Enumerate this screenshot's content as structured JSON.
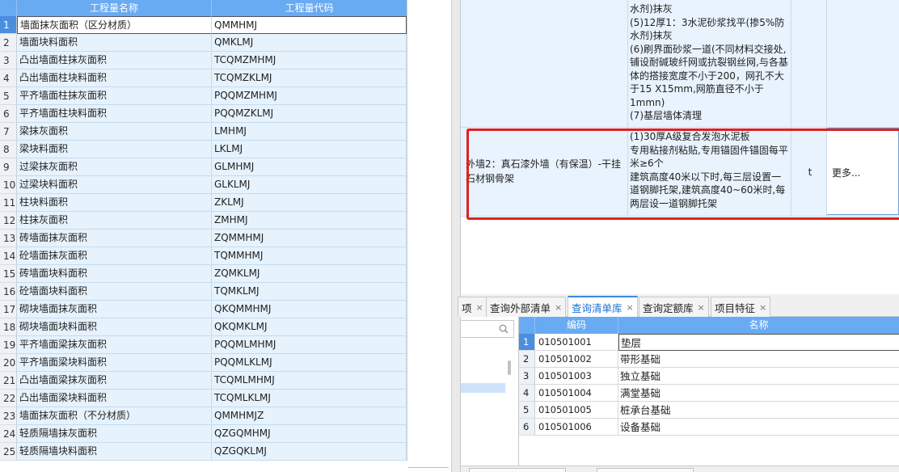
{
  "left_table": {
    "headers": {
      "name": "工程量名称",
      "code": "工程量代码"
    },
    "rows": [
      {
        "num": "1",
        "name": "墙面抹灰面积（区分材质）",
        "code": "QMMHMJ"
      },
      {
        "num": "2",
        "name": "墙面块料面积",
        "code": "QMKLMJ"
      },
      {
        "num": "3",
        "name": "凸出墙面柱抹灰面积",
        "code": "TCQMZMHMJ"
      },
      {
        "num": "4",
        "name": "凸出墙面柱块料面积",
        "code": "TCQMZKLMJ"
      },
      {
        "num": "5",
        "name": "平齐墙面柱抹灰面积",
        "code": "PQQMZMHMJ"
      },
      {
        "num": "6",
        "name": "平齐墙面柱块料面积",
        "code": "PQQMZKLMJ"
      },
      {
        "num": "7",
        "name": "梁抹灰面积",
        "code": "LMHMJ"
      },
      {
        "num": "8",
        "name": "梁块料面积",
        "code": "LKLMJ"
      },
      {
        "num": "9",
        "name": "过梁抹灰面积",
        "code": "GLMHMJ"
      },
      {
        "num": "10",
        "name": "过梁块料面积",
        "code": "GLKLMJ"
      },
      {
        "num": "11",
        "name": "柱块料面积",
        "code": "ZKLMJ"
      },
      {
        "num": "12",
        "name": "柱抹灰面积",
        "code": "ZMHMJ"
      },
      {
        "num": "13",
        "name": "砖墙面抹灰面积",
        "code": "ZQMMHMJ"
      },
      {
        "num": "14",
        "name": "砼墙面抹灰面积",
        "code": "TQMMHMJ"
      },
      {
        "num": "15",
        "name": "砖墙面块料面积",
        "code": "ZQMKLMJ"
      },
      {
        "num": "16",
        "name": "砼墙面块料面积",
        "code": "TQMKLMJ"
      },
      {
        "num": "17",
        "name": "砌块墙面抹灰面积",
        "code": "QKQMMHMJ"
      },
      {
        "num": "18",
        "name": "砌块墙面块料面积",
        "code": "QKQMKLMJ"
      },
      {
        "num": "19",
        "name": "平齐墙面梁抹灰面积",
        "code": "PQQMLMHMJ"
      },
      {
        "num": "20",
        "name": "平齐墙面梁块料面积",
        "code": "PQQMLKLMJ"
      },
      {
        "num": "21",
        "name": "凸出墙面梁抹灰面积",
        "code": "TCQMLMHMJ"
      },
      {
        "num": "22",
        "name": "凸出墙面梁块料面积",
        "code": "TCQMLKLMJ"
      },
      {
        "num": "23",
        "name": "墙面抹灰面积（不分材质）",
        "code": "QMMHMJZ"
      },
      {
        "num": "24",
        "name": "轻质隔墙抹灰面积",
        "code": "QZGQMHMJ"
      },
      {
        "num": "25",
        "name": "轻质隔墙块料面积",
        "code": "QZGQKLMJ"
      }
    ]
  },
  "upper_detail": {
    "row1_features": [
      "水剂)抹灰",
      "(5)12厚1：3水泥砂浆找平(掺5%防",
      "水剂)抹灰",
      "(6)刷界面砂浆一道(不同材料交接处,",
      "铺设耐碱玻纤网或抗裂钢丝网,与各基",
      "体的搭接宽度不小于200，网孔不大",
      "于15 X15mm,网筋直径不小于",
      "1mmn)",
      "(7)基层墙体清理"
    ],
    "row2_name": "外墙2：真石漆外墙（有保温）-干挂石材钢骨架",
    "row2_features": [
      "(1)30厚A级复合发泡水泥板",
      "专用粘接剂粘贴,专用锚固件锚固每平",
      "米≥6个",
      "建筑高度40米以下时,每三层设置一",
      "道钢脚托架,建筑高度40~60米时,每",
      "两层设一道钢脚托架"
    ],
    "row2_unit": "t",
    "row2_more": "更多..."
  },
  "tabs": [
    {
      "label": "项",
      "close": "×"
    },
    {
      "label": "查询外部清单",
      "close": "×"
    },
    {
      "label": "查询清单库",
      "close": "×"
    },
    {
      "label": "查询定额库",
      "close": "×"
    },
    {
      "label": "项目特征",
      "close": "×"
    }
  ],
  "query_table": {
    "headers": {
      "code": "编码",
      "name": "名称"
    },
    "rows": [
      {
        "num": "1",
        "code": "010501001",
        "name": "垫层"
      },
      {
        "num": "2",
        "code": "010501002",
        "name": "带形基础"
      },
      {
        "num": "3",
        "code": "010501003",
        "name": "独立基础"
      },
      {
        "num": "4",
        "code": "010501004",
        "name": "满堂基础"
      },
      {
        "num": "5",
        "code": "010501005",
        "name": "桩承台基础"
      },
      {
        "num": "6",
        "code": "010501006",
        "name": "设备基础"
      }
    ]
  },
  "colors": {
    "header_blue": "#69abf2",
    "row_blue": "#e6f2fc",
    "selection_blue": "#4a8ee0",
    "highlight_red": "#e02020",
    "active_tab": "#1a6fd6"
  }
}
